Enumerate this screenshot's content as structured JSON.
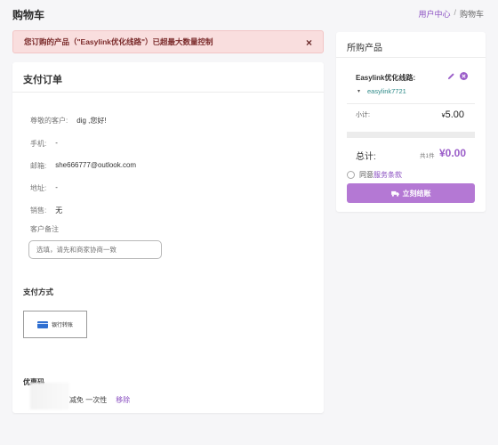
{
  "page": {
    "title": "购物车"
  },
  "breadcrumb": {
    "items": [
      "用户中心",
      "购物车"
    ],
    "separator": "/"
  },
  "alert": {
    "message": "您订购的产品（\"Easylink优化线路\"）已超最大数量控制",
    "close": "×"
  },
  "order": {
    "title": "支付订单",
    "greeting_label": "尊敬的客户:",
    "greeting_value": "dig ,您好!",
    "phone_label": "手机:",
    "phone_value": "-",
    "email_label": "邮箱:",
    "email_value": "she666777@outlook.com",
    "address_label": "地址:",
    "address_value": "-",
    "sales_label": "销售:",
    "sales_value": "无",
    "note_label": "客户备注",
    "note_placeholder": "选填，请先和商家协商一致",
    "payment_title": "支付方式",
    "payment_option": "银行转账",
    "coupon_title": "优惠码",
    "coupon_desc": "减免 一次性",
    "coupon_remove": "移除"
  },
  "products": {
    "title": "所购产品",
    "item_name": "Easylink优化线路:",
    "item_sub": "easylink7721",
    "subtotal_label": "小计:",
    "subtotal_currency": "¥",
    "subtotal_value": "5.00",
    "total_label": "总计:",
    "total_count": "共1件",
    "total_value": "¥0.00",
    "agree_text": "同意",
    "terms_text": "服务条款",
    "checkout_label": "立刻结账"
  },
  "colors": {
    "accent": "#9b5ec9",
    "button": "#b478d4",
    "alert_bg": "#f9dede",
    "link": "#8a4fc1"
  }
}
